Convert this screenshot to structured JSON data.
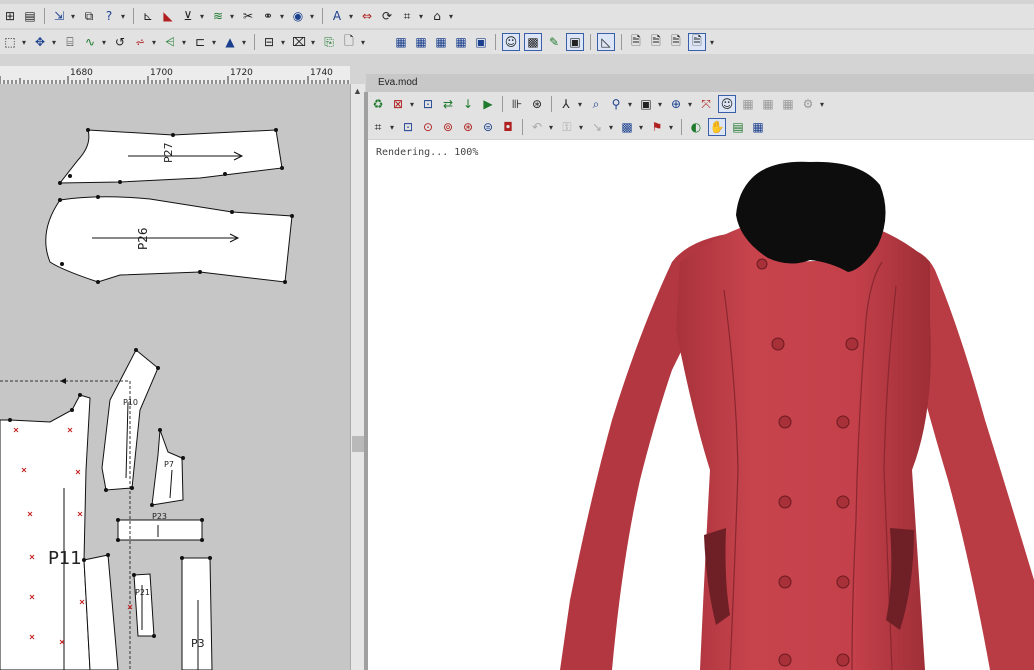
{
  "left_panel": {
    "ruler_ticks": [
      "1680",
      "1700",
      "1720",
      "1740"
    ],
    "pieces": [
      {
        "label": "P27"
      },
      {
        "label": "P26"
      },
      {
        "label": "P10"
      },
      {
        "label": "P7"
      },
      {
        "label": "P23"
      },
      {
        "label": "P11"
      },
      {
        "label": "P21"
      },
      {
        "label": "P3"
      }
    ]
  },
  "model_window": {
    "title": "Eva.mod",
    "render_status": "Rendering... 100%",
    "garment_colors": {
      "coat": "#c4404a",
      "collar": "#0d0d0d"
    }
  },
  "toolbars": {
    "row1_icons": [
      "grid-icon",
      "pattern-icon",
      "help-icon",
      "measure-icon",
      "flip-icon",
      "align-icon",
      "notch-icon",
      "dart-icon",
      "pleat-icon",
      "cut-icon",
      "sew-icon",
      "circle-icon",
      "text-icon",
      "mirror-icon",
      "rotate-icon",
      "fold-icon",
      "house-icon"
    ],
    "row2_icons": [
      "select-icon",
      "move-icon",
      "split-icon",
      "curve-icon",
      "rotate-left-icon",
      "grade-icon",
      "seam-icon",
      "marker-icon",
      "triangle-icon",
      "blank-icon",
      "shape-icon",
      "layout-icon",
      "doc-icon"
    ],
    "row2_right_icons": [
      "table-icon",
      "table2-icon",
      "table3-icon",
      "table4-icon",
      "calc-icon",
      "avatar-icon",
      "fabric-icon",
      "brush-icon",
      "frame-icon",
      "ruler-icon",
      "page-icon",
      "page2-icon",
      "page3-icon",
      "page4-icon"
    ],
    "model_row1_icons": [
      "recycle-icon",
      "stop-icon",
      "save-icon",
      "refresh-icon",
      "down-arrow-icon",
      "play-icon",
      "step-icon",
      "target-icon",
      "mannequin-icon",
      "zoom-icon",
      "zoom-fit-icon",
      "camera-icon",
      "zoom-in-icon",
      "fullscreen-icon",
      "avatar-icon",
      "grid1-icon",
      "grid2-icon",
      "grid3-icon",
      "settings-icon"
    ],
    "model_row2_icons": [
      "box-icon",
      "front-view-icon",
      "side-view-icon",
      "back-view-icon",
      "persp-icon",
      "top-view-icon",
      "undo-icon",
      "lock-icon",
      "arrow-icon",
      "light-icon",
      "flag-icon",
      "sphere-icon",
      "hand-icon",
      "image-icon",
      "scene-icon"
    ]
  }
}
